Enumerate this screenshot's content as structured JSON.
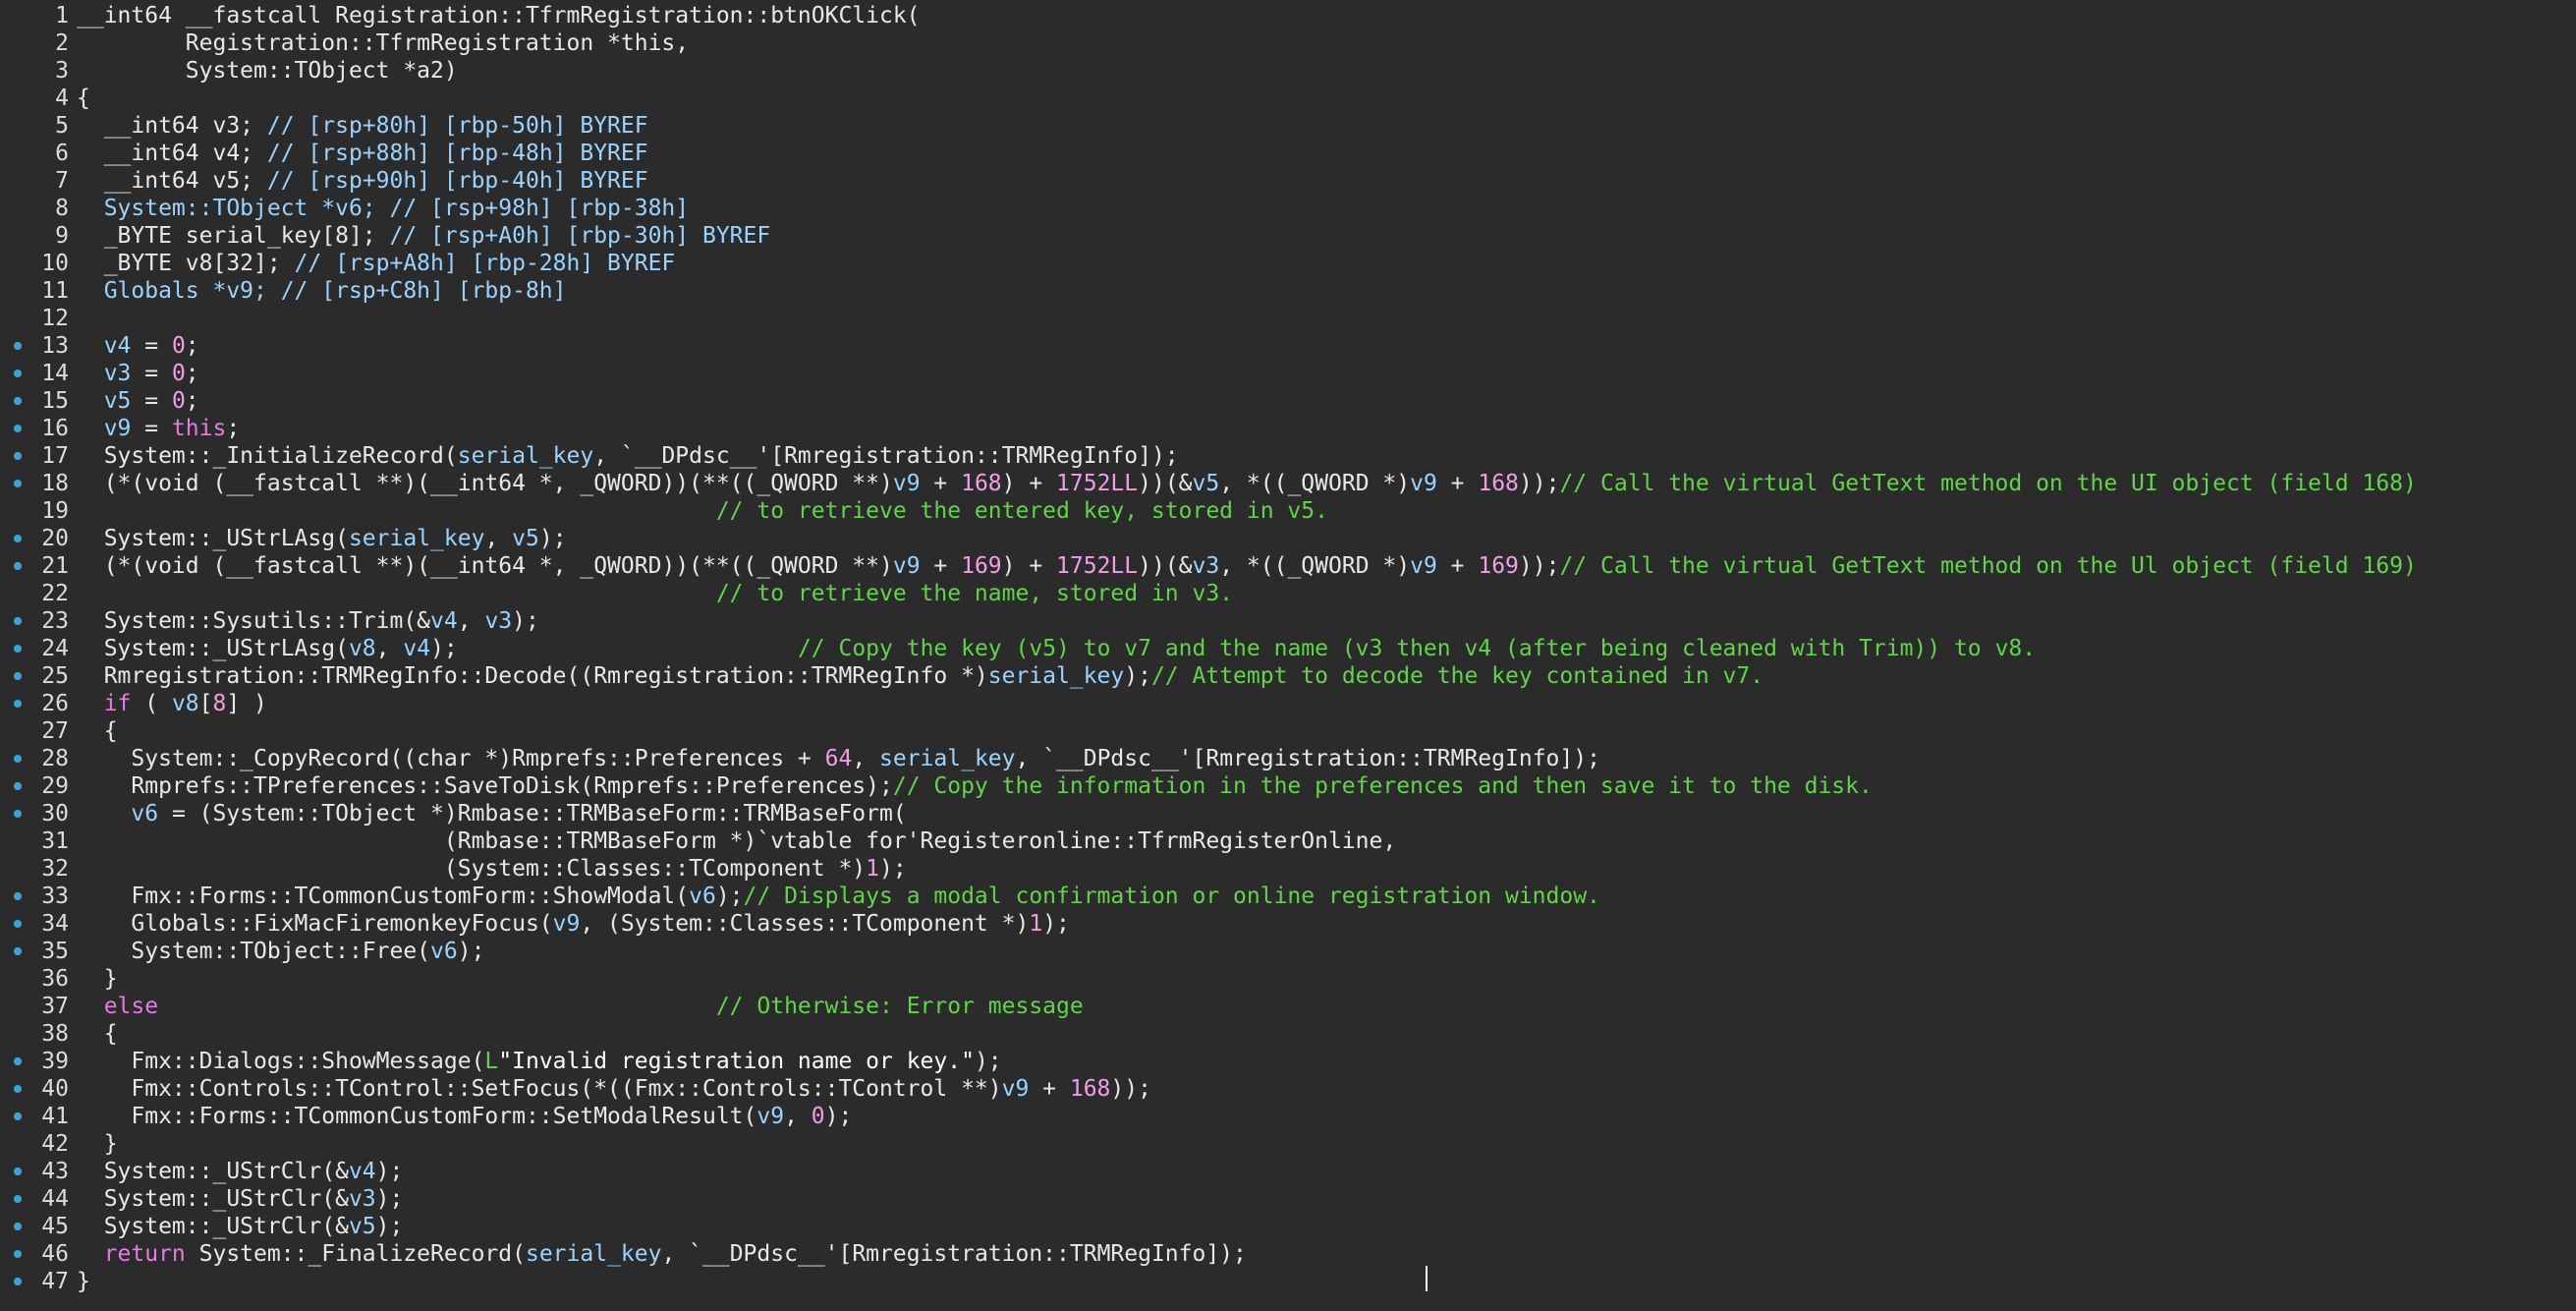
{
  "editor": {
    "lines": [
      {
        "num": "1",
        "bp": false,
        "segs": [
          [
            "p",
            "__int64 __fastcall Registration::TfrmRegistration::btnOKClick("
          ]
        ]
      },
      {
        "num": "2",
        "bp": false,
        "segs": [
          [
            "p",
            "        Registration::TfrmRegistration *this,"
          ]
        ]
      },
      {
        "num": "3",
        "bp": false,
        "segs": [
          [
            "p",
            "        System::TObject *a2)"
          ]
        ]
      },
      {
        "num": "4",
        "bp": false,
        "segs": [
          [
            "p",
            "{"
          ]
        ]
      },
      {
        "num": "5",
        "bp": false,
        "segs": [
          [
            "p",
            "  __int64 v3; "
          ],
          [
            "v",
            "// [rsp+80h] [rbp-50h] BYREF"
          ]
        ]
      },
      {
        "num": "6",
        "bp": false,
        "segs": [
          [
            "p",
            "  __int64 v4; "
          ],
          [
            "v",
            "// [rsp+88h] [rbp-48h] BYREF"
          ]
        ]
      },
      {
        "num": "7",
        "bp": false,
        "segs": [
          [
            "p",
            "  __int64 v5; "
          ],
          [
            "v",
            "// [rsp+90h] [rbp-40h] BYREF"
          ]
        ]
      },
      {
        "num": "8",
        "bp": false,
        "segs": [
          [
            "v",
            "  System::TObject *v6; // [rsp+98h] [rbp-38h]"
          ]
        ]
      },
      {
        "num": "9",
        "bp": false,
        "segs": [
          [
            "p",
            "  _BYTE serial_key[8]; "
          ],
          [
            "v",
            "// [rsp+A0h] [rbp-30h] BYREF"
          ]
        ]
      },
      {
        "num": "10",
        "bp": false,
        "segs": [
          [
            "p",
            "  _BYTE v8[32]; "
          ],
          [
            "v",
            "// [rsp+A8h] [rbp-28h] BYREF"
          ]
        ]
      },
      {
        "num": "11",
        "bp": false,
        "segs": [
          [
            "v",
            "  Globals *v9; // [rsp+C8h] [rbp-8h]"
          ]
        ]
      },
      {
        "num": "12",
        "bp": false,
        "segs": [
          [
            "p",
            ""
          ]
        ]
      },
      {
        "num": "13",
        "bp": true,
        "segs": [
          [
            "v",
            "  v4"
          ],
          [
            "p",
            " = "
          ],
          [
            "n",
            "0"
          ],
          [
            "p",
            ";"
          ]
        ]
      },
      {
        "num": "14",
        "bp": true,
        "segs": [
          [
            "v",
            "  v3"
          ],
          [
            "p",
            " = "
          ],
          [
            "n",
            "0"
          ],
          [
            "p",
            ";"
          ]
        ]
      },
      {
        "num": "15",
        "bp": true,
        "segs": [
          [
            "v",
            "  v5"
          ],
          [
            "p",
            " = "
          ],
          [
            "n",
            "0"
          ],
          [
            "p",
            ";"
          ]
        ]
      },
      {
        "num": "16",
        "bp": true,
        "segs": [
          [
            "v",
            "  v9"
          ],
          [
            "p",
            " = "
          ],
          [
            "k",
            "this"
          ],
          [
            "p",
            ";"
          ]
        ]
      },
      {
        "num": "17",
        "bp": true,
        "segs": [
          [
            "p",
            "  System::_InitializeRecord("
          ],
          [
            "v",
            "serial_key"
          ],
          [
            "p",
            ", `__DPdsc__'[Rmregistration::TRMRegInfo]);"
          ]
        ]
      },
      {
        "num": "18",
        "bp": true,
        "segs": [
          [
            "p",
            "  (*(void (__fastcall **)(__int64 *, _QWORD))(**((_QWORD **)"
          ],
          [
            "v",
            "v9"
          ],
          [
            "p",
            " + "
          ],
          [
            "n",
            "168"
          ],
          [
            "p",
            ") + "
          ],
          [
            "n",
            "1752LL"
          ],
          [
            "p",
            "))(&"
          ],
          [
            "v",
            "v5"
          ],
          [
            "p",
            ", *((_QWORD *)"
          ],
          [
            "v",
            "v9"
          ],
          [
            "p",
            " + "
          ],
          [
            "n",
            "168"
          ],
          [
            "p",
            "));"
          ],
          [
            "c",
            "// Call the virtual GetText method on the UI object (field 168)"
          ]
        ]
      },
      {
        "num": "19",
        "bp": false,
        "segs": [
          [
            "c",
            "                                               // to retrieve the entered key, stored in v5."
          ]
        ]
      },
      {
        "num": "20",
        "bp": true,
        "segs": [
          [
            "p",
            "  System::_UStrLAsg("
          ],
          [
            "v",
            "serial_key"
          ],
          [
            "p",
            ", "
          ],
          [
            "v",
            "v5"
          ],
          [
            "p",
            ");"
          ]
        ]
      },
      {
        "num": "21",
        "bp": true,
        "segs": [
          [
            "p",
            "  (*(void (__fastcall **)(__int64 *, _QWORD))(**((_QWORD **)"
          ],
          [
            "v",
            "v9"
          ],
          [
            "p",
            " + "
          ],
          [
            "n",
            "169"
          ],
          [
            "p",
            ") + "
          ],
          [
            "n",
            "1752LL"
          ],
          [
            "p",
            "))(&"
          ],
          [
            "v",
            "v3"
          ],
          [
            "p",
            ", *((_QWORD *)"
          ],
          [
            "v",
            "v9"
          ],
          [
            "p",
            " + "
          ],
          [
            "n",
            "169"
          ],
          [
            "p",
            "));"
          ],
          [
            "c",
            "// Call the virtual GetText method on the Ul object (field 169)"
          ]
        ]
      },
      {
        "num": "22",
        "bp": false,
        "segs": [
          [
            "c",
            "                                               // to retrieve the name, stored in v3."
          ]
        ]
      },
      {
        "num": "23",
        "bp": true,
        "segs": [
          [
            "p",
            "  System::Sysutils::Trim(&"
          ],
          [
            "v",
            "v4"
          ],
          [
            "p",
            ", "
          ],
          [
            "v",
            "v3"
          ],
          [
            "p",
            ");"
          ]
        ]
      },
      {
        "num": "24",
        "bp": true,
        "segs": [
          [
            "p",
            "  System::_UStrLAsg("
          ],
          [
            "v",
            "v8"
          ],
          [
            "p",
            ", "
          ],
          [
            "v",
            "v4"
          ],
          [
            "p",
            ");"
          ],
          [
            "c",
            "                         // Copy the key (v5) to v7 and the name (v3 then v4 (after being cleaned with Trim)) to v8."
          ]
        ]
      },
      {
        "num": "25",
        "bp": true,
        "segs": [
          [
            "p",
            "  Rmregistration::TRMRegInfo::Decode((Rmregistration::TRMRegInfo *)"
          ],
          [
            "v",
            "serial_key"
          ],
          [
            "p",
            ");"
          ],
          [
            "c",
            "// Attempt to decode the key contained in v7."
          ]
        ]
      },
      {
        "num": "26",
        "bp": true,
        "segs": [
          [
            "k",
            "  if"
          ],
          [
            "p",
            " ( "
          ],
          [
            "v",
            "v8"
          ],
          [
            "p",
            "["
          ],
          [
            "n",
            "8"
          ],
          [
            "p",
            "] )"
          ]
        ]
      },
      {
        "num": "27",
        "bp": false,
        "segs": [
          [
            "p",
            "  {"
          ]
        ]
      },
      {
        "num": "28",
        "bp": true,
        "segs": [
          [
            "p",
            "    System::_CopyRecord((char *)Rmprefs::Preferences + "
          ],
          [
            "n",
            "64"
          ],
          [
            "p",
            ", "
          ],
          [
            "v",
            "serial_key"
          ],
          [
            "p",
            ", `__DPdsc__'[Rmregistration::TRMRegInfo]);"
          ]
        ]
      },
      {
        "num": "29",
        "bp": true,
        "segs": [
          [
            "p",
            "    Rmprefs::TPreferences::SaveToDisk(Rmprefs::Preferences);"
          ],
          [
            "c",
            "// Copy the information in the preferences and then save it to the disk."
          ]
        ]
      },
      {
        "num": "30",
        "bp": true,
        "segs": [
          [
            "v",
            "    v6"
          ],
          [
            "p",
            " = (System::TObject *)Rmbase::TRMBaseForm::TRMBaseForm("
          ]
        ]
      },
      {
        "num": "31",
        "bp": false,
        "segs": [
          [
            "p",
            "                           (Rmbase::TRMBaseForm *)`vtable for'Registeronline::TfrmRegisterOnline,"
          ]
        ]
      },
      {
        "num": "32",
        "bp": false,
        "segs": [
          [
            "p",
            "                           (System::Classes::TComponent *)"
          ],
          [
            "n",
            "1"
          ],
          [
            "p",
            ");"
          ]
        ]
      },
      {
        "num": "33",
        "bp": true,
        "segs": [
          [
            "p",
            "    Fmx::Forms::TCommonCustomForm::ShowModal("
          ],
          [
            "v",
            "v6"
          ],
          [
            "p",
            ");"
          ],
          [
            "c",
            "// Displays a modal confirmation or online registration window."
          ]
        ]
      },
      {
        "num": "34",
        "bp": true,
        "segs": [
          [
            "p",
            "    Globals::FixMacFiremonkeyFocus("
          ],
          [
            "v",
            "v9"
          ],
          [
            "p",
            ", (System::Classes::TComponent *)"
          ],
          [
            "n",
            "1"
          ],
          [
            "p",
            ");"
          ]
        ]
      },
      {
        "num": "35",
        "bp": true,
        "segs": [
          [
            "p",
            "    System::TObject::Free("
          ],
          [
            "v",
            "v6"
          ],
          [
            "p",
            ");"
          ]
        ]
      },
      {
        "num": "36",
        "bp": false,
        "segs": [
          [
            "p",
            "  }"
          ]
        ]
      },
      {
        "num": "37",
        "bp": false,
        "segs": [
          [
            "k",
            "  else"
          ],
          [
            "c",
            "                                         // Otherwise: Error message"
          ]
        ]
      },
      {
        "num": "38",
        "bp": false,
        "segs": [
          [
            "p",
            "  {"
          ]
        ]
      },
      {
        "num": "39",
        "bp": true,
        "segs": [
          [
            "p",
            "    Fmx::Dialogs::ShowMessage("
          ],
          [
            "c",
            "L"
          ],
          [
            "s",
            "\"Invalid registration name or key.\""
          ],
          [
            "p",
            ");"
          ]
        ]
      },
      {
        "num": "40",
        "bp": true,
        "segs": [
          [
            "p",
            "    Fmx::Controls::TControl::SetFocus(*((Fmx::Controls::TControl **)"
          ],
          [
            "v",
            "v9"
          ],
          [
            "p",
            " + "
          ],
          [
            "n",
            "168"
          ],
          [
            "p",
            "));"
          ]
        ]
      },
      {
        "num": "41",
        "bp": true,
        "segs": [
          [
            "p",
            "    Fmx::Forms::TCommonCustomForm::SetModalResult("
          ],
          [
            "v",
            "v9"
          ],
          [
            "p",
            ", "
          ],
          [
            "n",
            "0"
          ],
          [
            "p",
            ");"
          ]
        ]
      },
      {
        "num": "42",
        "bp": false,
        "segs": [
          [
            "p",
            "  }"
          ]
        ]
      },
      {
        "num": "43",
        "bp": true,
        "segs": [
          [
            "p",
            "  System::_UStrClr(&"
          ],
          [
            "v",
            "v4"
          ],
          [
            "p",
            ");"
          ]
        ]
      },
      {
        "num": "44",
        "bp": true,
        "segs": [
          [
            "p",
            "  System::_UStrClr(&"
          ],
          [
            "v",
            "v3"
          ],
          [
            "p",
            ");"
          ]
        ]
      },
      {
        "num": "45",
        "bp": true,
        "segs": [
          [
            "p",
            "  System::_UStrClr(&"
          ],
          [
            "v",
            "v5"
          ],
          [
            "p",
            ");"
          ]
        ]
      },
      {
        "num": "46",
        "bp": true,
        "segs": [
          [
            "k",
            "  return"
          ],
          [
            "p",
            " System::_FinalizeRecord("
          ],
          [
            "v",
            "serial_key"
          ],
          [
            "p",
            ", `__DPdsc__'[Rmregistration::TRMRegInfo]);"
          ]
        ]
      },
      {
        "num": "47",
        "bp": true,
        "segs": [
          [
            "p",
            "}"
          ]
        ]
      }
    ]
  },
  "colors": {
    "background": "#2b2b2b",
    "plain": "#e8e8e8",
    "variable": "#9bd3ff",
    "comment": "#62d44a",
    "keyword": "#e57be0",
    "number": "#f29de8",
    "breakpoint": "#3ba3d8"
  }
}
